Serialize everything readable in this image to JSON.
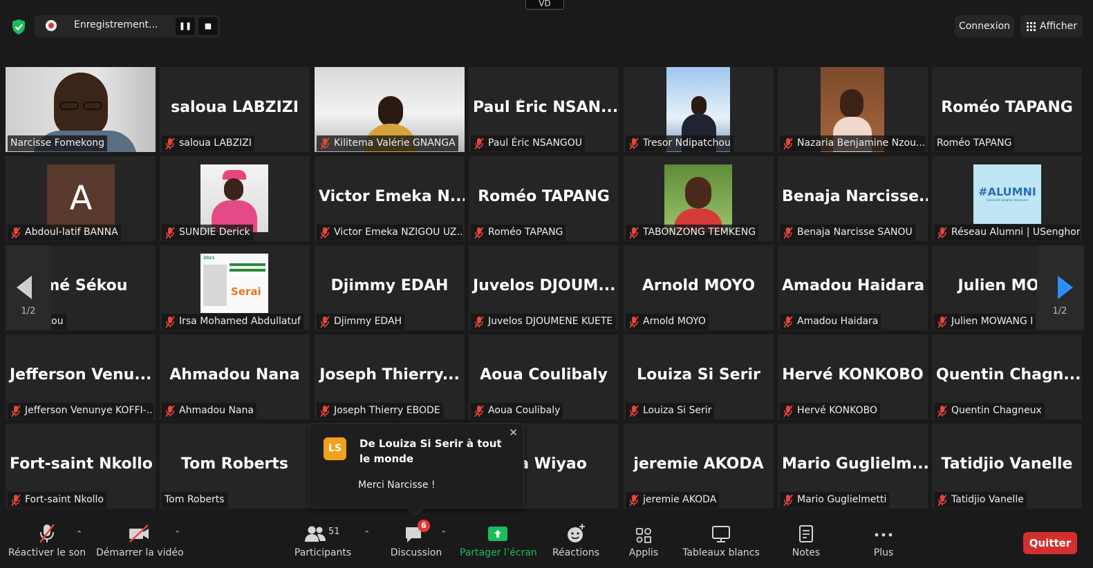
{
  "topbar": {
    "recording_label": "Enregistrement...",
    "view_tab": "VD",
    "connexion_label": "Connexion",
    "afficher_label": "Afficher"
  },
  "tiles": [
    {
      "name": "",
      "label": "Narcisse Fomekong",
      "muted": false,
      "photo": "person-1",
      "active": true
    },
    {
      "name": "saloua LABZIZI",
      "label": "saloua LABZIZI",
      "muted": true
    },
    {
      "name": "",
      "label": "Kilitema Valérie GNANGA",
      "muted": true,
      "photo": "person-2"
    },
    {
      "name": "Paul Éric NSAN...",
      "label": "Paul Éric NSANGOU",
      "muted": true
    },
    {
      "name": "",
      "label": "Tresor Ndipatchou",
      "muted": true,
      "photo": "person-3"
    },
    {
      "name": "",
      "label": "Nazaria Benjamine Nzou...",
      "muted": true,
      "photo": "person-4"
    },
    {
      "name": "Roméo TAPANG",
      "label": "Roméo TAPANG",
      "muted": false
    },
    {
      "name": "",
      "label": "Abdoul-latif BANNA",
      "muted": true,
      "photo": "avatar-letter",
      "letter": "A"
    },
    {
      "name": "",
      "label": "SUNDIE Derick",
      "muted": true,
      "photo": "person-5"
    },
    {
      "name": "Victor Emeka N...",
      "label": "Victor Emeka NZIGOU UZ...",
      "muted": true
    },
    {
      "name": "Roméo TAPANG",
      "label": "Roméo TAPANG",
      "muted": true
    },
    {
      "name": "",
      "label": "TABONZONG TEMKENG",
      "muted": true,
      "photo": "person-6"
    },
    {
      "name": "Benaja Narcisse...",
      "label": "Benaja Narcisse SANOU",
      "muted": true
    },
    {
      "name": "",
      "label": "Réseau Alumni | USenghor",
      "muted": true,
      "photo": "alumni-logo",
      "logo_text": "#ALUMNI",
      "logo_sub": "Université Senghor Alexandrie"
    },
    {
      "name": "amé Sékou",
      "label": "é Sékou",
      "muted": true
    },
    {
      "name": "",
      "label": "Irsa Mohamed Abdullatuf",
      "muted": true,
      "photo": "poster",
      "poster_year": "2021",
      "poster_title": "Serai"
    },
    {
      "name": "Djimmy EDAH",
      "label": "Djimmy EDAH",
      "muted": true
    },
    {
      "name": "Juvelos DJOUM...",
      "label": "Juvelos DJOUMENE KUETE",
      "muted": true
    },
    {
      "name": "Arnold MOYO",
      "label": "Arnold MOYO",
      "muted": true
    },
    {
      "name": "Amadou Haidara",
      "label": "Amadou Haidara",
      "muted": true
    },
    {
      "name": "Julien MOW",
      "label": "Julien MOWANG I",
      "muted": true
    },
    {
      "name": "Jefferson Venu...",
      "label": "Jefferson Venunye KOFFI-...",
      "muted": true
    },
    {
      "name": "Ahmadou Nana",
      "label": "Ahmadou Nana",
      "muted": true
    },
    {
      "name": "Joseph Thierry...",
      "label": "Joseph Thierry EBODE",
      "muted": true
    },
    {
      "name": "Aoua Coulibaly",
      "label": "Aoua Coulibaly",
      "muted": true
    },
    {
      "name": "Louiza Si Serir",
      "label": "Louiza Si Serir",
      "muted": true
    },
    {
      "name": "Hervé KONKOBO",
      "label": "Hervé KONKOBO",
      "muted": true
    },
    {
      "name": "Quentin Chagn...",
      "label": "Quentin Chagneux",
      "muted": true
    },
    {
      "name": "Fort-saint Nkollo",
      "label": "Fort-saint Nkollo",
      "muted": true
    },
    {
      "name": "Tom Roberts",
      "label": "Tom Roberts",
      "muted": false
    },
    {
      "name": "",
      "label": "",
      "muted": false
    },
    {
      "name": "cca Wiyao",
      "label": "a Wiyao",
      "muted": false
    },
    {
      "name": "jeremie AKODA",
      "label": "jeremie AKODA",
      "muted": true
    },
    {
      "name": "Mario Guglielm...",
      "label": "Mario Guglielmetti",
      "muted": true
    },
    {
      "name": "Tatidjio Vanelle",
      "label": "Tatidjio Vanelle",
      "muted": true
    }
  ],
  "pager": {
    "left_page": "1/2",
    "right_page": "1/2"
  },
  "toast": {
    "avatar": "LS",
    "title": "De Louiza Si Serir à tout le monde",
    "message": "Merci Narcisse !"
  },
  "toolbar": {
    "unmute": "Réactiver le son",
    "start_video": "Démarrer la vidéo",
    "participants": "Participants",
    "participants_count": "51",
    "chat": "Discussion",
    "chat_badge": "6",
    "share": "Partager l’écran",
    "reactions": "Réactions",
    "apps": "Applis",
    "whiteboards": "Tableaux blancs",
    "notes": "Notes",
    "more": "Plus",
    "quit": "Quitter"
  },
  "colors": {
    "active_speaker": "#c4e34b",
    "muted_icon": "#e5463b",
    "share_green": "#1dbb5d",
    "quit_red": "#d32f2f",
    "badge_red": "#e53935",
    "toast_avatar": "#f2a11e"
  }
}
